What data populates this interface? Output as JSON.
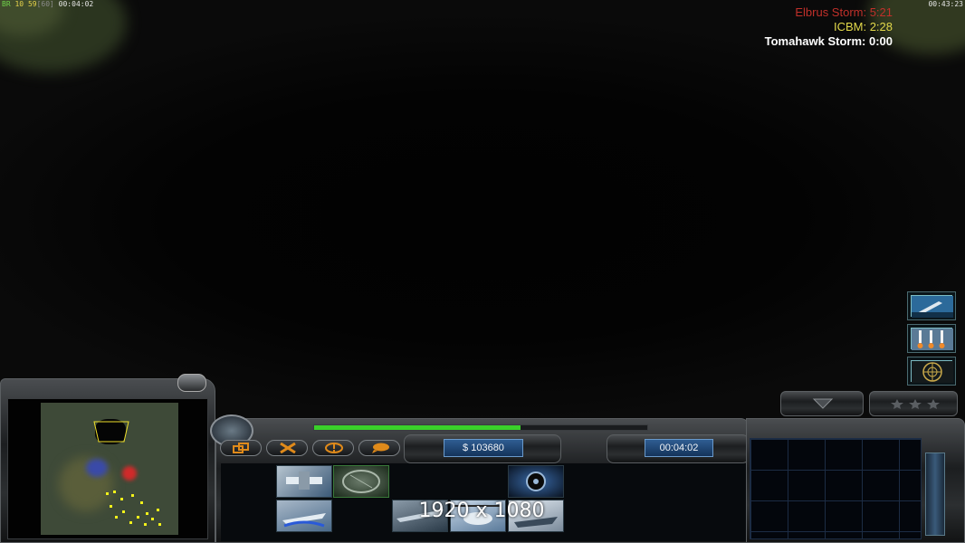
{
  "debug_left": {
    "prefix": "BR",
    "a": "10",
    "b": "59",
    "c": "[60]",
    "time": "00:04:02"
  },
  "clock_right": "00:43:23",
  "superweapons": [
    {
      "label": "Elbrus Storm: 5:21",
      "color": "#c0302a"
    },
    {
      "label": "ICBM: 2:28",
      "color": "#e2d84a"
    },
    {
      "label": "Tomahawk Storm: 0:00",
      "color": "#ffffff"
    }
  ],
  "hud": {
    "money": "$ 103680",
    "time": "00:04:02",
    "power_fraction": 0.62,
    "resolution_overlay": "1920 x 1080"
  },
  "colors": {
    "power_bar": "#3ad12a",
    "readout": "#1f4a7c",
    "minimap_units": "#f2f21a"
  },
  "icons": {
    "command_buttons": [
      "options-icon",
      "repair-icon",
      "alert-icon",
      "chat-icon"
    ],
    "side_powers": [
      "missile-launch-icon",
      "rocket-barrage-icon",
      "radar-scan-icon"
    ]
  }
}
